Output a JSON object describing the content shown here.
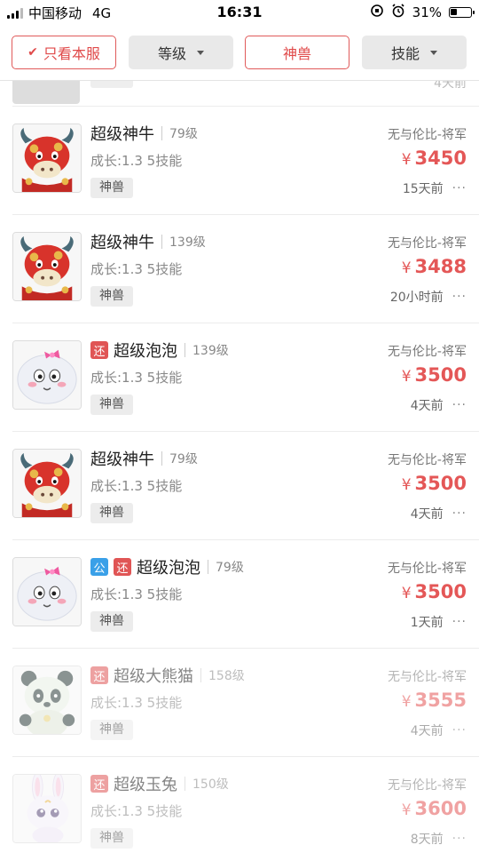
{
  "status_bar": {
    "carrier": "中国移动",
    "network": "4G",
    "time": "16:31",
    "battery": "31%",
    "battery_level": 0.31
  },
  "filters": [
    {
      "label": "只看本服",
      "style": "red",
      "check": true,
      "caret": false
    },
    {
      "label": "等级",
      "style": "gray",
      "check": false,
      "caret": true
    },
    {
      "label": "神兽",
      "style": "red",
      "check": false,
      "caret": false
    },
    {
      "label": "技能",
      "style": "gray",
      "check": false,
      "caret": true
    }
  ],
  "icons": {
    "check": "✔",
    "more": "···",
    "yen": "¥"
  },
  "partial_item": {
    "time": "4天前"
  },
  "items": [
    {
      "name": "超级神牛",
      "level": "79级",
      "growth": "成长:1.3  5技能",
      "tag": "神兽",
      "server": "无与伦比-将军",
      "price": "3450",
      "time": "15天前",
      "badges": [],
      "pet": "ox",
      "faded": false
    },
    {
      "name": "超级神牛",
      "level": "139级",
      "growth": "成长:1.3  5技能",
      "tag": "神兽",
      "server": "无与伦比-将军",
      "price": "3488",
      "time": "20小时前",
      "badges": [],
      "pet": "ox",
      "faded": false
    },
    {
      "name": "超级泡泡",
      "level": "139级",
      "growth": "成长:1.3  5技能",
      "tag": "神兽",
      "server": "无与伦比-将军",
      "price": "3500",
      "time": "4天前",
      "badges": [
        "还"
      ],
      "pet": "bubble",
      "faded": false
    },
    {
      "name": "超级神牛",
      "level": "79级",
      "growth": "成长:1.3  5技能",
      "tag": "神兽",
      "server": "无与伦比-将军",
      "price": "3500",
      "time": "4天前",
      "badges": [],
      "pet": "ox",
      "faded": false
    },
    {
      "name": "超级泡泡",
      "level": "79级",
      "growth": "成长:1.3  5技能",
      "tag": "神兽",
      "server": "无与伦比-将军",
      "price": "3500",
      "time": "1天前",
      "badges": [
        "公",
        "还"
      ],
      "pet": "bubble",
      "faded": false
    },
    {
      "name": "超级大熊猫",
      "level": "158级",
      "growth": "成长:1.3  5技能",
      "tag": "神兽",
      "server": "无与伦比-将军",
      "price": "3555",
      "time": "4天前",
      "badges": [
        "还"
      ],
      "pet": "panda",
      "faded": true
    },
    {
      "name": "超级玉兔",
      "level": "150级",
      "growth": "成长:1.3  5技能",
      "tag": "神兽",
      "server": "无与伦比-将军",
      "price": "3600",
      "time": "8天前",
      "badges": [
        "还"
      ],
      "pet": "rabbit",
      "faded": true
    }
  ]
}
